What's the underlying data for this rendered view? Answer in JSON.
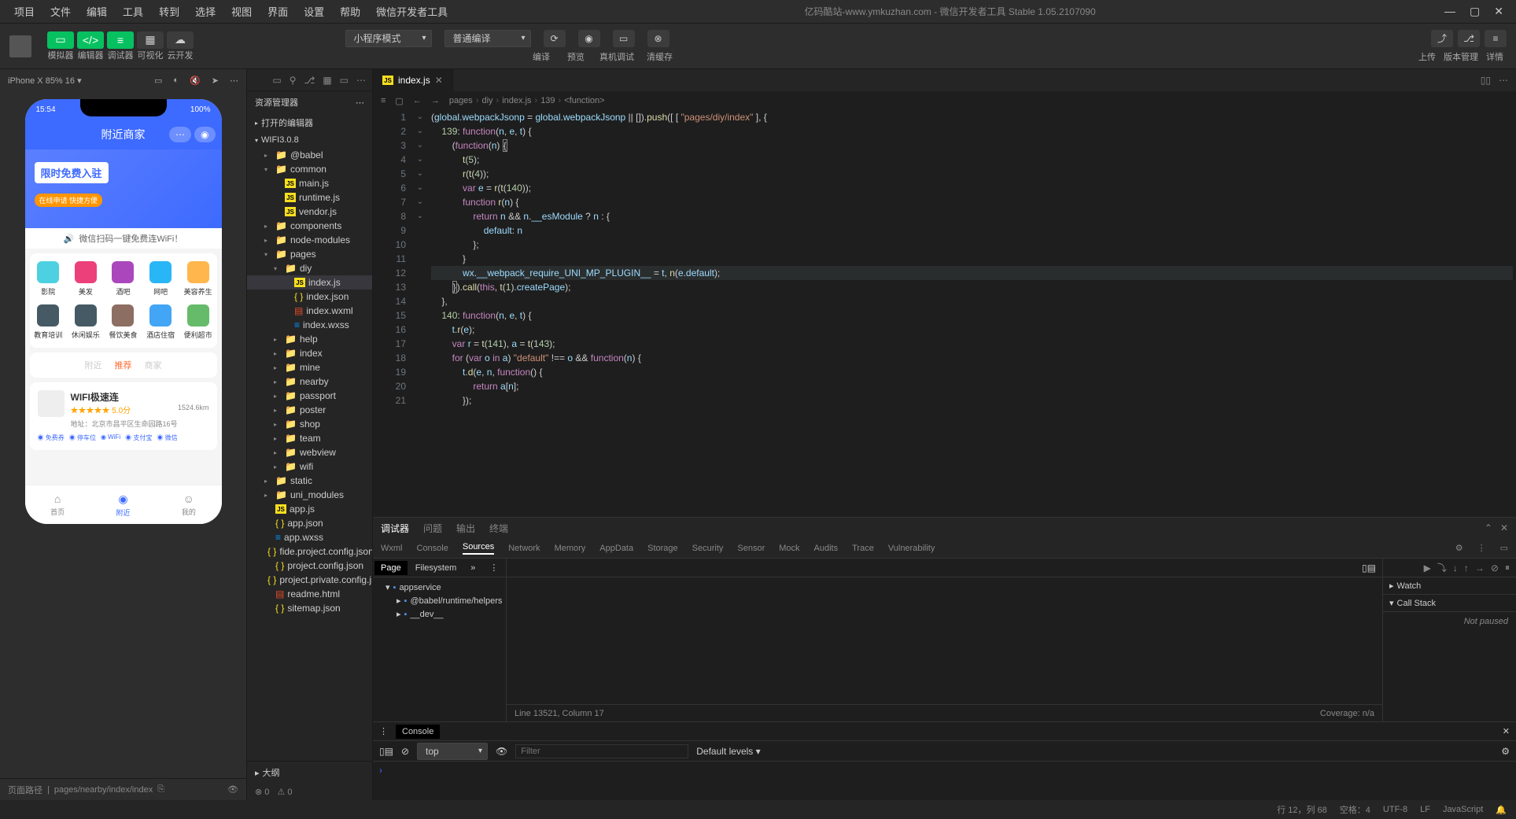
{
  "menubar": {
    "items": [
      "项目",
      "文件",
      "编辑",
      "工具",
      "转到",
      "选择",
      "视图",
      "界面",
      "设置",
      "帮助",
      "微信开发者工具"
    ],
    "title": "亿码酷站-www.ymkuzhan.com - 微信开发者工具 Stable 1.05.2107090"
  },
  "toolbar": {
    "modes": {
      "simulator": "模拟器",
      "editor": "编辑器",
      "debugger": "调试器",
      "visual": "可视化",
      "cloud": "云开发"
    },
    "mode_select": "小程序模式",
    "compile_select": "普通编译",
    "actions": {
      "compile": "编译",
      "preview": "预览",
      "remote": "真机调试",
      "cache": "清缓存"
    },
    "right": {
      "upload": "上传",
      "version": "版本管理",
      "detail": "详情"
    }
  },
  "simulator": {
    "device": "iPhone X 85% 16 ▾",
    "phone": {
      "time": "15:54",
      "battery": "100%",
      "title": "附近商家",
      "banner_title": "限时免费入驻",
      "banner_sub": "在线申请 快捷方便",
      "scan_text": "微信扫码一键免费连WiFi！",
      "grid": [
        {
          "label": "影院",
          "color": "#4dd0e1"
        },
        {
          "label": "美发",
          "color": "#ec407a"
        },
        {
          "label": "酒吧",
          "color": "#ab47bc"
        },
        {
          "label": "网吧",
          "color": "#29b6f6"
        },
        {
          "label": "美容养生",
          "color": "#ffb74d"
        },
        {
          "label": "教育培训",
          "color": "#455a64"
        },
        {
          "label": "休闲娱乐",
          "color": "#455a64"
        },
        {
          "label": "餐饮美食",
          "color": "#8d6e63"
        },
        {
          "label": "酒店住宿",
          "color": "#42a5f5"
        },
        {
          "label": "便利超市",
          "color": "#66bb6a"
        }
      ],
      "tabs": [
        "附近",
        "推荐",
        "商家"
      ],
      "card": {
        "title": "WIFI极速连",
        "rating": "5.0分",
        "distance": "1524.6km",
        "address": "地址：北京市昌平区生命园路16号",
        "tags": [
          "◉ 免费券",
          "◉ 停车位",
          "◉ WiFi",
          "◉ 支付宝",
          "◉ 微信"
        ]
      },
      "tabbar": [
        {
          "label": "首页",
          "icon": "⌂"
        },
        {
          "label": "附近",
          "icon": "◉"
        },
        {
          "label": "我的",
          "icon": "☺"
        }
      ]
    },
    "footer_path": "pages/nearby/index/index",
    "footer_label": "页面路径"
  },
  "explorer": {
    "title": "资源管理器",
    "sections": {
      "open_editors": "打开的编辑器",
      "project": "WIFI3.0.8",
      "outline": "大纲"
    },
    "tree": [
      {
        "depth": 1,
        "chev": "▸",
        "icon": "folder",
        "label": "@babel"
      },
      {
        "depth": 1,
        "chev": "▾",
        "icon": "folder",
        "label": "common"
      },
      {
        "depth": 2,
        "chev": "",
        "icon": "js",
        "label": "main.js"
      },
      {
        "depth": 2,
        "chev": "",
        "icon": "js",
        "label": "runtime.js"
      },
      {
        "depth": 2,
        "chev": "",
        "icon": "js",
        "label": "vendor.js"
      },
      {
        "depth": 1,
        "chev": "▸",
        "icon": "folder",
        "label": "components"
      },
      {
        "depth": 1,
        "chev": "▸",
        "icon": "folder",
        "label": "node-modules"
      },
      {
        "depth": 1,
        "chev": "▾",
        "icon": "folder",
        "label": "pages"
      },
      {
        "depth": 2,
        "chev": "▾",
        "icon": "folder",
        "label": "diy"
      },
      {
        "depth": 3,
        "chev": "",
        "icon": "js",
        "label": "index.js",
        "selected": true
      },
      {
        "depth": 3,
        "chev": "",
        "icon": "json",
        "label": "index.json"
      },
      {
        "depth": 3,
        "chev": "",
        "icon": "wxml",
        "label": "index.wxml"
      },
      {
        "depth": 3,
        "chev": "",
        "icon": "wxss",
        "label": "index.wxss"
      },
      {
        "depth": 2,
        "chev": "▸",
        "icon": "folder",
        "label": "help"
      },
      {
        "depth": 2,
        "chev": "▸",
        "icon": "folder",
        "label": "index"
      },
      {
        "depth": 2,
        "chev": "▸",
        "icon": "folder",
        "label": "mine"
      },
      {
        "depth": 2,
        "chev": "▸",
        "icon": "folder",
        "label": "nearby"
      },
      {
        "depth": 2,
        "chev": "▸",
        "icon": "folder",
        "label": "passport"
      },
      {
        "depth": 2,
        "chev": "▸",
        "icon": "folder",
        "label": "poster"
      },
      {
        "depth": 2,
        "chev": "▸",
        "icon": "folder",
        "label": "shop"
      },
      {
        "depth": 2,
        "chev": "▸",
        "icon": "folder",
        "label": "team"
      },
      {
        "depth": 2,
        "chev": "▸",
        "icon": "folder",
        "label": "webview"
      },
      {
        "depth": 2,
        "chev": "▸",
        "icon": "folder",
        "label": "wifi"
      },
      {
        "depth": 1,
        "chev": "▸",
        "icon": "folder",
        "label": "static"
      },
      {
        "depth": 1,
        "chev": "▸",
        "icon": "folder",
        "label": "uni_modules"
      },
      {
        "depth": 1,
        "chev": "",
        "icon": "js",
        "label": "app.js"
      },
      {
        "depth": 1,
        "chev": "",
        "icon": "json",
        "label": "app.json"
      },
      {
        "depth": 1,
        "chev": "",
        "icon": "wxss",
        "label": "app.wxss"
      },
      {
        "depth": 1,
        "chev": "",
        "icon": "json",
        "label": "fide.project.config.json"
      },
      {
        "depth": 1,
        "chev": "",
        "icon": "json",
        "label": "project.config.json"
      },
      {
        "depth": 1,
        "chev": "",
        "icon": "json",
        "label": "project.private.config.js..."
      },
      {
        "depth": 1,
        "chev": "",
        "icon": "wxml",
        "label": "readme.html"
      },
      {
        "depth": 1,
        "chev": "",
        "icon": "json",
        "label": "sitemap.json"
      }
    ],
    "errors": "0",
    "warnings": "0"
  },
  "editor": {
    "tab": "index.js",
    "breadcrumb": [
      "pages",
      "diy",
      "index.js",
      "139",
      "<function>"
    ],
    "lines": [
      {
        "n": 1,
        "fold": "⌄",
        "html": "(<span class='prop'>global</span>.<span class='prop'>webpackJsonp</span> = <span class='prop'>global</span>.<span class='prop'>webpackJsonp</span> || []).<span class='fn'>push</span>([ [ <span class='str'>\"pages/diy/index\"</span> ], {"
      },
      {
        "n": 2,
        "fold": "⌄",
        "html": "    <span class='num'>139</span>: <span class='kw'>function</span>(<span class='var'>n</span>, <span class='var'>e</span>, <span class='var'>t</span>) {"
      },
      {
        "n": 3,
        "fold": "⌄",
        "html": "        (<span class='kw'>function</span>(<span class='var'>n</span>) <span style='border:1px solid #888'>{</span>"
      },
      {
        "n": 4,
        "fold": "",
        "html": "            <span class='fn'>t</span>(<span class='num'>5</span>);"
      },
      {
        "n": 5,
        "fold": "",
        "html": "            <span class='fn'>r</span>(<span class='fn'>t</span>(<span class='num'>4</span>));"
      },
      {
        "n": 6,
        "fold": "",
        "html": "            <span class='kw'>var</span> <span class='var'>e</span> = <span class='fn'>r</span>(<span class='fn'>t</span>(<span class='num'>140</span>));"
      },
      {
        "n": 7,
        "fold": "⌄",
        "html": "            <span class='kw'>function</span> <span class='fn'>r</span>(<span class='var'>n</span>) {"
      },
      {
        "n": 8,
        "fold": "⌄",
        "html": "                <span class='kw'>return</span> <span class='var'>n</span> && <span class='var'>n</span>.<span class='prop'>__esModule</span> ? <span class='var'>n</span> : {"
      },
      {
        "n": 9,
        "fold": "",
        "html": "                    <span class='prop'>default</span>: <span class='var'>n</span>"
      },
      {
        "n": 10,
        "fold": "",
        "html": "                };"
      },
      {
        "n": 11,
        "fold": "",
        "html": "            }"
      },
      {
        "n": 12,
        "fold": "",
        "hl": true,
        "html": "            <span class='prop'>wx</span>.<span class='prop'>__webpack_require_UNI_MP_PLUGIN__</span> = <span class='var'>t</span>, <span class='fn'>n</span>(<span class='var'>e</span>.<span class='prop'>default</span>);"
      },
      {
        "n": 13,
        "fold": "",
        "html": "        <span style='border:1px solid #888'>}</span>).<span class='fn'>call</span>(<span class='kw'>this</span>, <span class='fn'>t</span>(<span class='num'>1</span>).<span class='prop'>createPage</span>);"
      },
      {
        "n": 14,
        "fold": "",
        "html": "    },"
      },
      {
        "n": 15,
        "fold": "⌄",
        "html": "    <span class='num'>140</span>: <span class='kw'>function</span>(<span class='var'>n</span>, <span class='var'>e</span>, <span class='var'>t</span>) {"
      },
      {
        "n": 16,
        "fold": "",
        "html": "        <span class='var'>t</span>.<span class='fn'>r</span>(<span class='var'>e</span>);"
      },
      {
        "n": 17,
        "fold": "",
        "html": "        <span class='kw'>var</span> <span class='var'>r</span> = <span class='fn'>t</span>(<span class='num'>141</span>), <span class='var'>a</span> = <span class='fn'>t</span>(<span class='num'>143</span>);"
      },
      {
        "n": 18,
        "fold": "⌄",
        "html": "        <span class='kw'>for</span> (<span class='kw'>var</span> <span class='var'>o</span> <span class='kw'>in</span> <span class='var'>a</span>) <span class='str'>\"default\"</span> !== <span class='var'>o</span> && <span class='kw'>function</span>(<span class='var'>n</span>) {"
      },
      {
        "n": 19,
        "fold": "⌄",
        "html": "            <span class='var'>t</span>.<span class='fn'>d</span>(<span class='var'>e</span>, <span class='var'>n</span>, <span class='kw'>function</span>() {"
      },
      {
        "n": 20,
        "fold": "",
        "html": "                <span class='kw'>return</span> <span class='var'>a</span>[<span class='var'>n</span>];"
      },
      {
        "n": 21,
        "fold": "",
        "html": "            });"
      }
    ]
  },
  "devtools": {
    "top_tabs": [
      "调试器",
      "问题",
      "输出",
      "终端"
    ],
    "sub_tabs": [
      "Wxml",
      "Console",
      "Sources",
      "Network",
      "Memory",
      "AppData",
      "Storage",
      "Security",
      "Sensor",
      "Mock",
      "Audits",
      "Trace",
      "Vulnerability"
    ],
    "sources": {
      "tabs": [
        "Page",
        "Filesystem",
        "»"
      ],
      "tree": [
        {
          "depth": 0,
          "chev": "▾",
          "icon": "📁",
          "label": "appservice",
          "color": "#4a90e2"
        },
        {
          "depth": 1,
          "chev": "▸",
          "icon": "📁",
          "label": "@babel/runtime/helpers",
          "color": "#4a90e2"
        },
        {
          "depth": 1,
          "chev": "▸",
          "icon": "📁",
          "label": "__dev__",
          "color": "#4a90e2"
        }
      ],
      "status": "Line 13521, Column 17",
      "coverage": "Coverage: n/a",
      "watch": "Watch",
      "callstack": "Call Stack",
      "not_paused": "Not paused"
    },
    "console": {
      "label": "Console",
      "context": "top",
      "filter_placeholder": "Filter",
      "levels": "Default levels ▾"
    }
  },
  "statusbar": {
    "pos": "行 12，列 68",
    "spaces": "空格：4",
    "encoding": "UTF-8",
    "eol": "LF",
    "lang": "JavaScript",
    "bell": "🔔"
  }
}
